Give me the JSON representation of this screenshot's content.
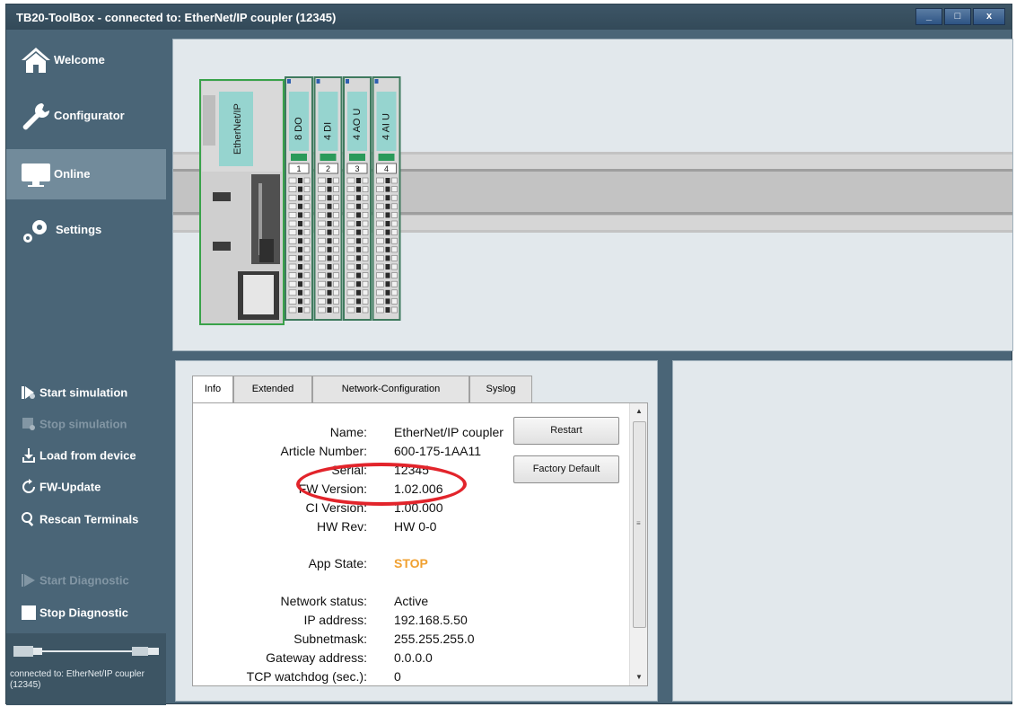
{
  "window": {
    "title": "TB20-ToolBox - connected to: EtherNet/IP coupler (12345)",
    "controls": {
      "minimize": "_",
      "maximize": "□",
      "close": "x"
    }
  },
  "sidebar": {
    "nav": [
      {
        "label": "Welcome",
        "icon": "home-icon",
        "active": false
      },
      {
        "label": "Configurator",
        "icon": "wrench-icon",
        "active": false
      },
      {
        "label": "Online",
        "icon": "monitor-icon",
        "active": true
      },
      {
        "label": "Settings",
        "icon": "gears-icon",
        "active": false
      }
    ],
    "actions": [
      {
        "label": "Start simulation",
        "icon": "start-simulation-icon",
        "enabled": true
      },
      {
        "label": "Stop simulation",
        "icon": "stop-simulation-icon",
        "enabled": false
      },
      {
        "label": "Load from device",
        "icon": "download-icon",
        "enabled": true
      },
      {
        "label": "FW-Update",
        "icon": "refresh-icon",
        "enabled": true
      },
      {
        "label": "Rescan Terminals",
        "icon": "search-icon",
        "enabled": true
      },
      {
        "label": "Start Diagnostic",
        "icon": "play-icon",
        "enabled": false
      },
      {
        "label": "Stop Diagnostic",
        "icon": "stop-icon",
        "enabled": true
      }
    ],
    "status": "connected to: EtherNet/IP coupler (12345)"
  },
  "device": {
    "coupler_label": "EtherNet/IP",
    "modules": [
      {
        "label": "8 DO",
        "slot": "1"
      },
      {
        "label": "4 DI",
        "slot": "2"
      },
      {
        "label": "4 AO U",
        "slot": "3"
      },
      {
        "label": "4 AI U",
        "slot": "4"
      }
    ]
  },
  "info_panel": {
    "tabs": [
      "Info",
      "Extended",
      "Network-Configuration",
      "Syslog"
    ],
    "active_tab": "Info",
    "rows": [
      {
        "key": "Name:",
        "value": "EtherNet/IP coupler"
      },
      {
        "key": "Article Number:",
        "value": "600-175-1AA11"
      },
      {
        "key": "Serial:",
        "value": "12345"
      },
      {
        "key": "FW Version:",
        "value": "1.02.006"
      },
      {
        "key": "CI Version:",
        "value": "1.00.000"
      },
      {
        "key": "HW Rev:",
        "value": "HW 0-0"
      },
      {
        "key": "App State:",
        "value": "STOP"
      },
      {
        "key": "Network status:",
        "value": "Active"
      },
      {
        "key": "IP address:",
        "value": "192.168.5.50"
      },
      {
        "key": "Subnetmask:",
        "value": "255.255.255.0"
      },
      {
        "key": "Gateway address:",
        "value": "0.0.0.0"
      },
      {
        "key": "TCP watchdog (sec.):",
        "value": "0"
      }
    ],
    "buttons": {
      "restart": "Restart",
      "factory_default": "Factory Default"
    }
  },
  "colors": {
    "sidebar_bg": "#4a6577",
    "active_nav": "#728b9b",
    "panel_bg": "#e2e8ec",
    "app_state_stop": "#f0a030",
    "highlight_ring": "#e2242b",
    "module_green": "#2b9a5a"
  }
}
